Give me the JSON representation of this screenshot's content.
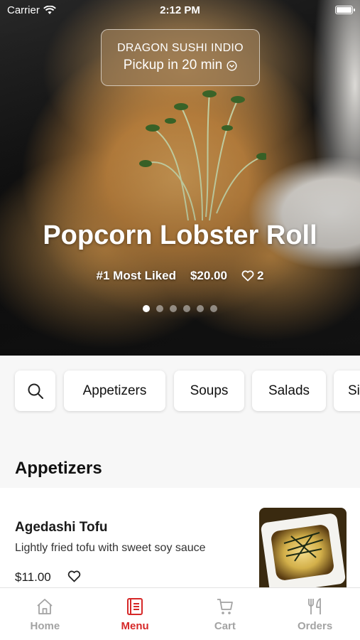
{
  "status_bar": {
    "carrier": "Carrier",
    "time": "2:12 PM"
  },
  "pickup": {
    "restaurant": "DRAGON SUSHI INDIO",
    "time_label": "Pickup in 20 min"
  },
  "hero": {
    "title": "Popcorn Lobster Roll",
    "badge": "#1 Most Liked",
    "price": "$20.00",
    "likes": "2",
    "carousel": {
      "count": 6,
      "active_index": 0
    }
  },
  "categories": {
    "search_icon": "search-icon",
    "items": [
      "Appetizers",
      "Soups",
      "Salads",
      "Si"
    ]
  },
  "section": {
    "title": "Appetizers"
  },
  "menu_item": {
    "name": "Agedashi Tofu",
    "description": "Lightly fried tofu with sweet soy sauce",
    "price": "$11.00"
  },
  "tab_bar": {
    "active": "Menu",
    "accent_color": "#d62828",
    "inactive_color": "#a3a3a3",
    "tabs": [
      {
        "label": "Home",
        "icon": "home-icon"
      },
      {
        "label": "Menu",
        "icon": "menu-icon"
      },
      {
        "label": "Cart",
        "icon": "cart-icon"
      },
      {
        "label": "Orders",
        "icon": "fork-knife-icon"
      }
    ]
  }
}
